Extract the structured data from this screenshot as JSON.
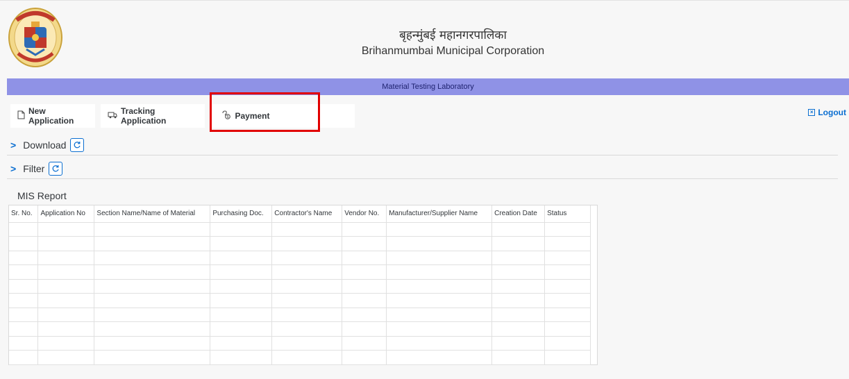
{
  "header": {
    "title_hindi": "बृहन्मुंबई महानगरपालिका",
    "title_english": "Brihanmumbai Municipal Corporation"
  },
  "banner": {
    "text": "Material Testing Laboratory"
  },
  "toolbar": {
    "new_application": "New Application",
    "tracking_application": "Tracking Application",
    "payment": "Payment",
    "logout": "Logout"
  },
  "sections": {
    "download": "Download",
    "filter": "Filter"
  },
  "report": {
    "title": "MIS Report",
    "columns": [
      "Sr. No.",
      "Application No",
      "Section Name/Name of Material",
      "Purchasing Doc.",
      "Contractor's Name",
      "Vendor No.",
      "Manufacturer/Supplier Name",
      "Creation Date",
      "Status"
    ]
  },
  "colors": {
    "banner_bg": "#8f92e6",
    "accent": "#0a6ed1",
    "highlight": "#e10000"
  }
}
